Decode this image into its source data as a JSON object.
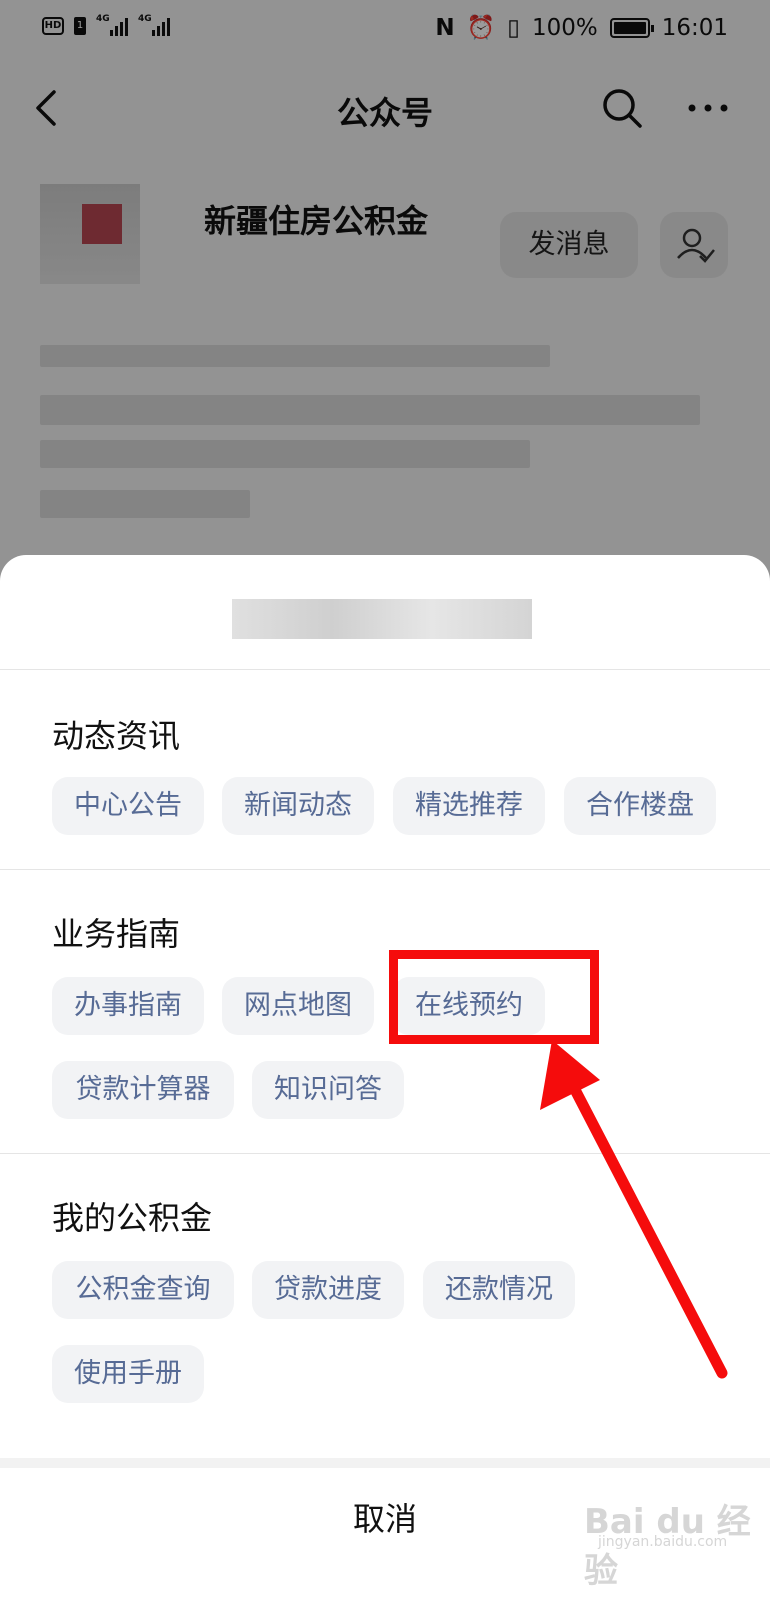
{
  "status_bar": {
    "sim_label": "HD",
    "sim_num": "1",
    "network_1": "4G",
    "network_2": "4G",
    "battery": "100%",
    "time": "16:01"
  },
  "nav": {
    "title": "公众号",
    "icons": [
      "back-icon",
      "search-icon",
      "more-icon"
    ]
  },
  "profile": {
    "account_name": "新疆住房公积金",
    "message_button": "发消息"
  },
  "sheet": {
    "sections": [
      {
        "title": "动态资讯",
        "items": [
          "中心公告",
          "新闻动态",
          "精选推荐",
          "合作楼盘"
        ]
      },
      {
        "title": "业务指南",
        "items": [
          "办事指南",
          "网点地图",
          "在线预约",
          "贷款计算器",
          "知识问答"
        ]
      },
      {
        "title": "我的公积金",
        "items": [
          "公积金查询",
          "贷款进度",
          "还款情况",
          "使用手册"
        ]
      }
    ],
    "cancel": "取消"
  },
  "annotation": {
    "highlighted_item": "在线预约",
    "color": "#f50c0c"
  },
  "watermark": {
    "main": "Bai du 经验",
    "sub": "jingyan.baidu.com"
  },
  "colors": {
    "chip_text": "#576b95",
    "chip_bg": "#f2f3f5"
  }
}
